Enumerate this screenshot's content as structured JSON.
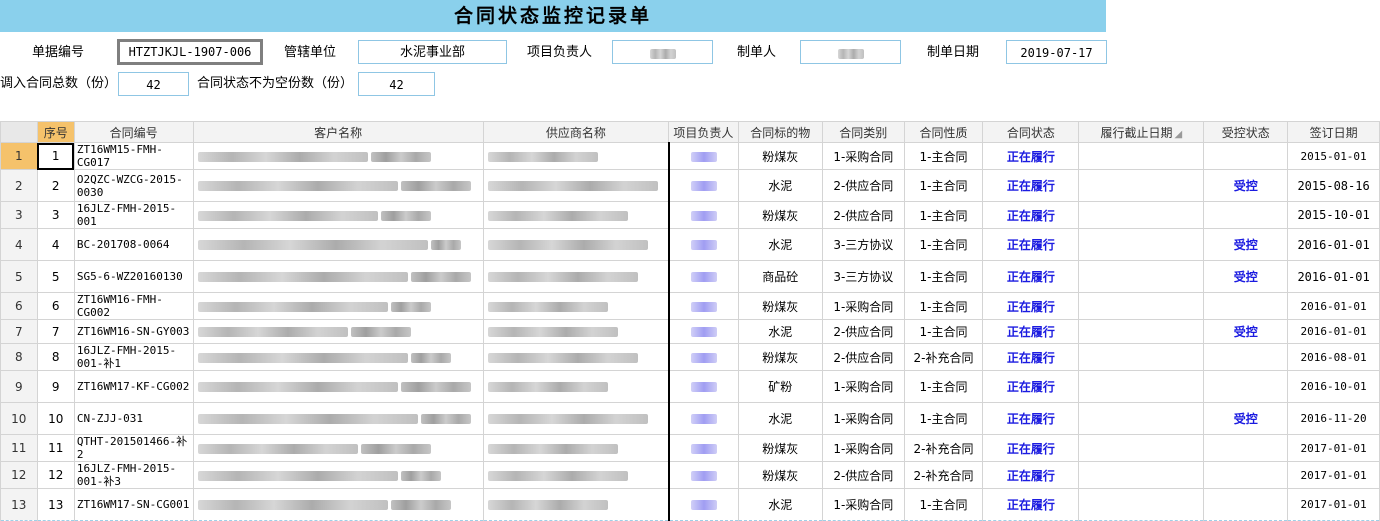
{
  "title": "合同状态监控记录单",
  "header": {
    "doc_no_label": "单据编号",
    "doc_no_value": "HTZTJKJL-1907-006",
    "unit_label": "管辖单位",
    "unit_value": "水泥事业部",
    "manager_label": "项目负责人",
    "creator_label": "制单人",
    "date_label": "制单日期",
    "date_value": "2019-07-17",
    "total_label": "调入合同总数（份）",
    "total_value": "42",
    "nonempty_label": "合同状态不为空份数（份）",
    "nonempty_value": "42"
  },
  "columns": [
    "序号",
    "合同编号",
    "客户名称",
    "供应商名称",
    "项目负责人",
    "合同标的物",
    "合同类别",
    "合同性质",
    "合同状态",
    "履行截止日期",
    "受控状态",
    "签订日期"
  ],
  "rows": [
    {
      "rn": "1",
      "seq": "1",
      "code": "ZT16WM15-FMH-CG017",
      "subject": "粉煤灰",
      "type": "1-采购合同",
      "nature": "1-主合同",
      "status": "正在履行",
      "control": "",
      "date": "2015-01-01",
      "big": false
    },
    {
      "rn": "2",
      "seq": "2",
      "code": "O2QZC-WZCG-2015-0030",
      "subject": "水泥",
      "type": "2-供应合同",
      "nature": "1-主合同",
      "status": "正在履行",
      "control": "受控",
      "date": "2015-08-16",
      "big": true
    },
    {
      "rn": "3",
      "seq": "3",
      "code": "16JLZ-FMH-2015-001",
      "subject": "粉煤灰",
      "type": "2-供应合同",
      "nature": "1-主合同",
      "status": "正在履行",
      "control": "",
      "date": "2015-10-01",
      "big": true
    },
    {
      "rn": "4",
      "seq": "4",
      "code": "BC-201708-0064",
      "subject": "水泥",
      "type": "3-三方协议",
      "nature": "1-主合同",
      "status": "正在履行",
      "control": "受控",
      "date": "2016-01-01",
      "big": true
    },
    {
      "rn": "5",
      "seq": "5",
      "code": "SG5-6-WZ20160130",
      "subject": "商品砼",
      "type": "3-三方协议",
      "nature": "1-主合同",
      "status": "正在履行",
      "control": "受控",
      "date": "2016-01-01",
      "big": true
    },
    {
      "rn": "6",
      "seq": "6",
      "code": "ZT16WM16-FMH-CG002",
      "subject": "粉煤灰",
      "type": "1-采购合同",
      "nature": "1-主合同",
      "status": "正在履行",
      "control": "",
      "date": "2016-01-01",
      "big": false
    },
    {
      "rn": "7",
      "seq": "7",
      "code": "ZT16WM16-SN-GY003",
      "subject": "水泥",
      "type": "2-供应合同",
      "nature": "1-主合同",
      "status": "正在履行",
      "control": "受控",
      "date": "2016-01-01",
      "big": false
    },
    {
      "rn": "8",
      "seq": "8",
      "code": "16JLZ-FMH-2015-001-补1",
      "subject": "粉煤灰",
      "type": "2-供应合同",
      "nature": "2-补充合同",
      "status": "正在履行",
      "control": "",
      "date": "2016-08-01",
      "big": false
    },
    {
      "rn": "9",
      "seq": "9",
      "code": "ZT16WM17-KF-CG002",
      "subject": "矿粉",
      "type": "1-采购合同",
      "nature": "1-主合同",
      "status": "正在履行",
      "control": "",
      "date": "2016-10-01",
      "big": false
    },
    {
      "rn": "10",
      "seq": "10",
      "code": "CN-ZJJ-031",
      "subject": "水泥",
      "type": "1-采购合同",
      "nature": "1-主合同",
      "status": "正在履行",
      "control": "受控",
      "date": "2016-11-20",
      "big": false
    },
    {
      "rn": "11",
      "seq": "11",
      "code": "QTHT-201501466-补2",
      "subject": "粉煤灰",
      "type": "1-采购合同",
      "nature": "2-补充合同",
      "status": "正在履行",
      "control": "",
      "date": "2017-01-01",
      "big": false
    },
    {
      "rn": "12",
      "seq": "12",
      "code": "16JLZ-FMH-2015-001-补3",
      "subject": "粉煤灰",
      "type": "2-供应合同",
      "nature": "2-补充合同",
      "status": "正在履行",
      "control": "",
      "date": "2017-01-01",
      "big": false
    },
    {
      "rn": "13",
      "seq": "13",
      "code": "ZT16WM17-SN-CG001",
      "subject": "水泥",
      "type": "1-采购合同",
      "nature": "1-主合同",
      "status": "正在履行",
      "control": "",
      "date": "2017-01-01",
      "big": false
    }
  ]
}
